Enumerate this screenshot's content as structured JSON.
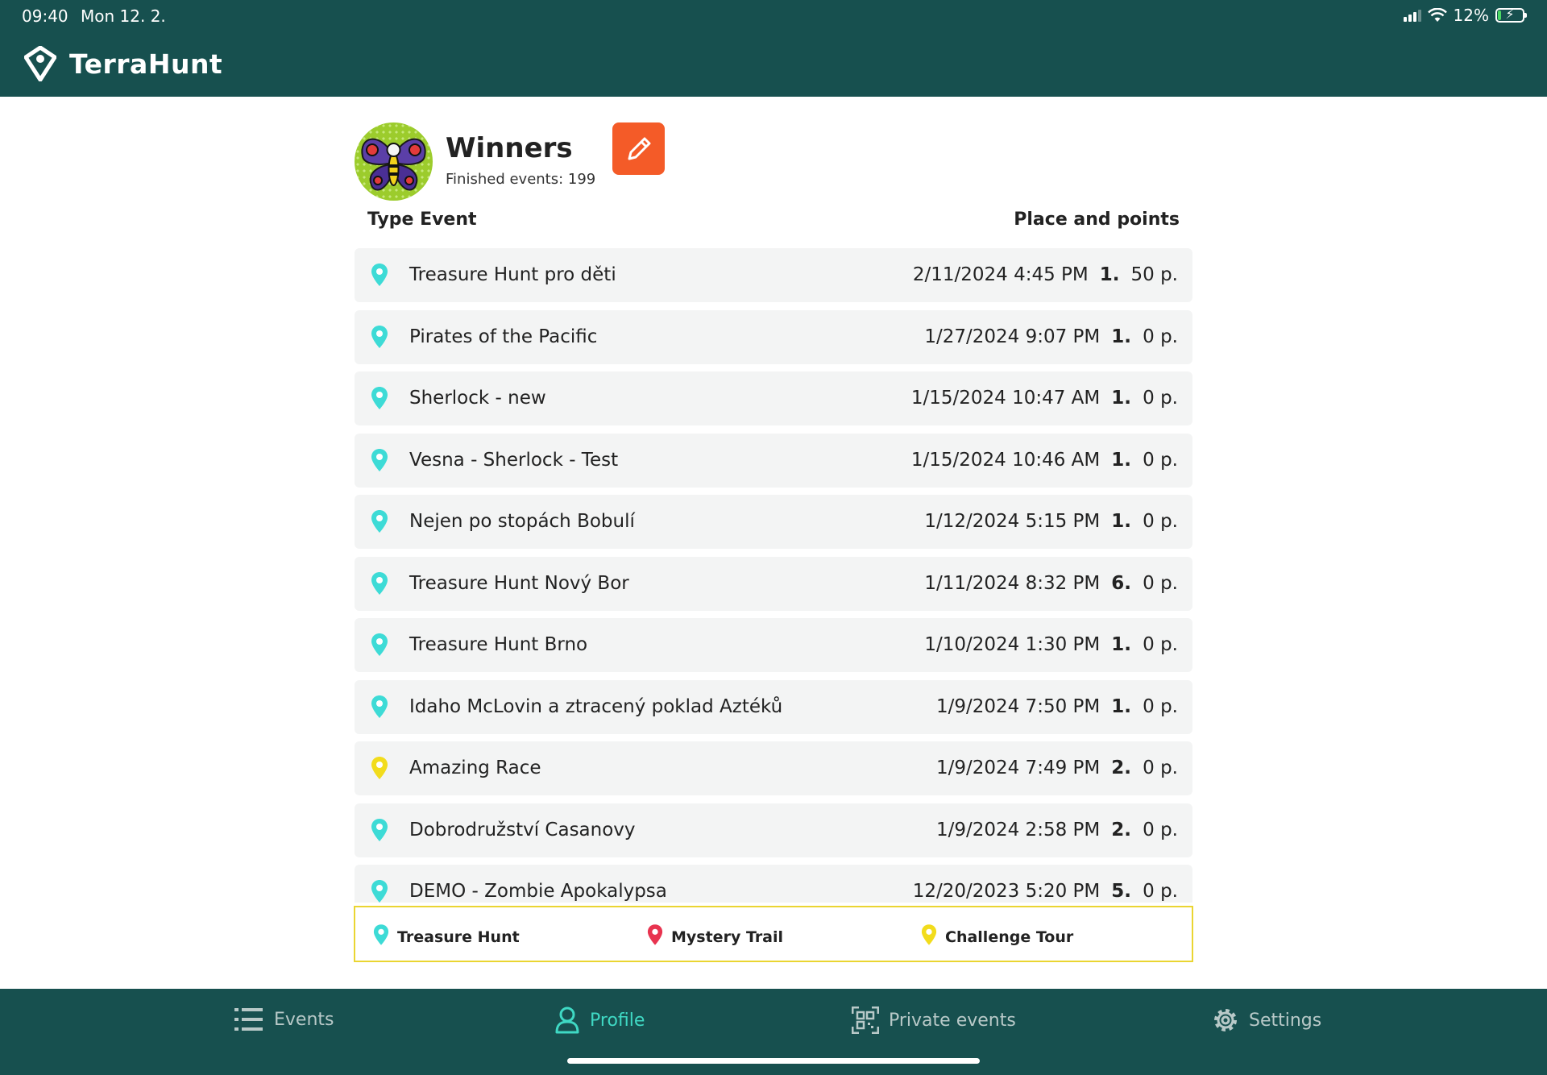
{
  "status_bar": {
    "time": "09:40",
    "date": "Mon 12. 2.",
    "battery": "12%",
    "battery_level": 0.12
  },
  "app": {
    "title": "TerraHunt"
  },
  "profile": {
    "name": "Winners",
    "subtitle": "Finished events: 199"
  },
  "columns": {
    "type_event": "Type  Event",
    "place_points": "Place and points"
  },
  "colors": {
    "header_bg": "#17504f",
    "treasure_hunt": "#3ddbd6",
    "mystery_trail": "#e8334f",
    "challenge_tour": "#f2dc1c",
    "accent_orange": "#f45b28",
    "nav_active": "#3fd9c4"
  },
  "events": [
    {
      "type": "treasure_hunt",
      "name": "Treasure Hunt pro děti",
      "date": "2/11/2024 4:45 PM",
      "place": "1.",
      "points": "50 p."
    },
    {
      "type": "treasure_hunt",
      "name": "Pirates of the Pacific",
      "date": "1/27/2024 9:07 PM",
      "place": "1.",
      "points": "0 p."
    },
    {
      "type": "treasure_hunt",
      "name": "Sherlock  - new",
      "date": "1/15/2024 10:47 AM",
      "place": "1.",
      "points": "0 p."
    },
    {
      "type": "treasure_hunt",
      "name": "Vesna - Sherlock - Test",
      "date": "1/15/2024 10:46 AM",
      "place": "1.",
      "points": "0 p."
    },
    {
      "type": "treasure_hunt",
      "name": "Nejen po stopách Bobulí",
      "date": "1/12/2024 5:15 PM",
      "place": "1.",
      "points": "0 p."
    },
    {
      "type": "treasure_hunt",
      "name": "Treasure Hunt Nový Bor",
      "date": "1/11/2024 8:32 PM",
      "place": "6.",
      "points": "0 p."
    },
    {
      "type": "treasure_hunt",
      "name": "Treasure Hunt Brno",
      "date": "1/10/2024 1:30 PM",
      "place": "1.",
      "points": "0 p."
    },
    {
      "type": "treasure_hunt",
      "name": "Idaho McLovin a ztracený poklad Aztéků",
      "date": "1/9/2024 7:50 PM",
      "place": "1.",
      "points": "0 p."
    },
    {
      "type": "challenge_tour",
      "name": "Amazing Race",
      "date": "1/9/2024 7:49 PM",
      "place": "2.",
      "points": "0 p."
    },
    {
      "type": "treasure_hunt",
      "name": "Dobrodružství Casanovy",
      "date": "1/9/2024 2:58 PM",
      "place": "2.",
      "points": "0 p."
    },
    {
      "type": "treasure_hunt",
      "name": "DEMO - Zombie Apokalypsa",
      "date": "12/20/2023 5:20 PM",
      "place": "5.",
      "points": "0 p."
    }
  ],
  "legend": [
    {
      "type": "treasure_hunt",
      "label": "Treasure Hunt"
    },
    {
      "type": "mystery_trail",
      "label": "Mystery Trail"
    },
    {
      "type": "challenge_tour",
      "label": "Challenge Tour"
    }
  ],
  "nav": [
    {
      "label": "Events",
      "icon": "list-icon",
      "active": false
    },
    {
      "label": "Profile",
      "icon": "user-icon",
      "active": true
    },
    {
      "label": "Private events",
      "icon": "qr-code-icon",
      "active": false
    },
    {
      "label": "Settings",
      "icon": "gear-icon",
      "active": false
    }
  ]
}
